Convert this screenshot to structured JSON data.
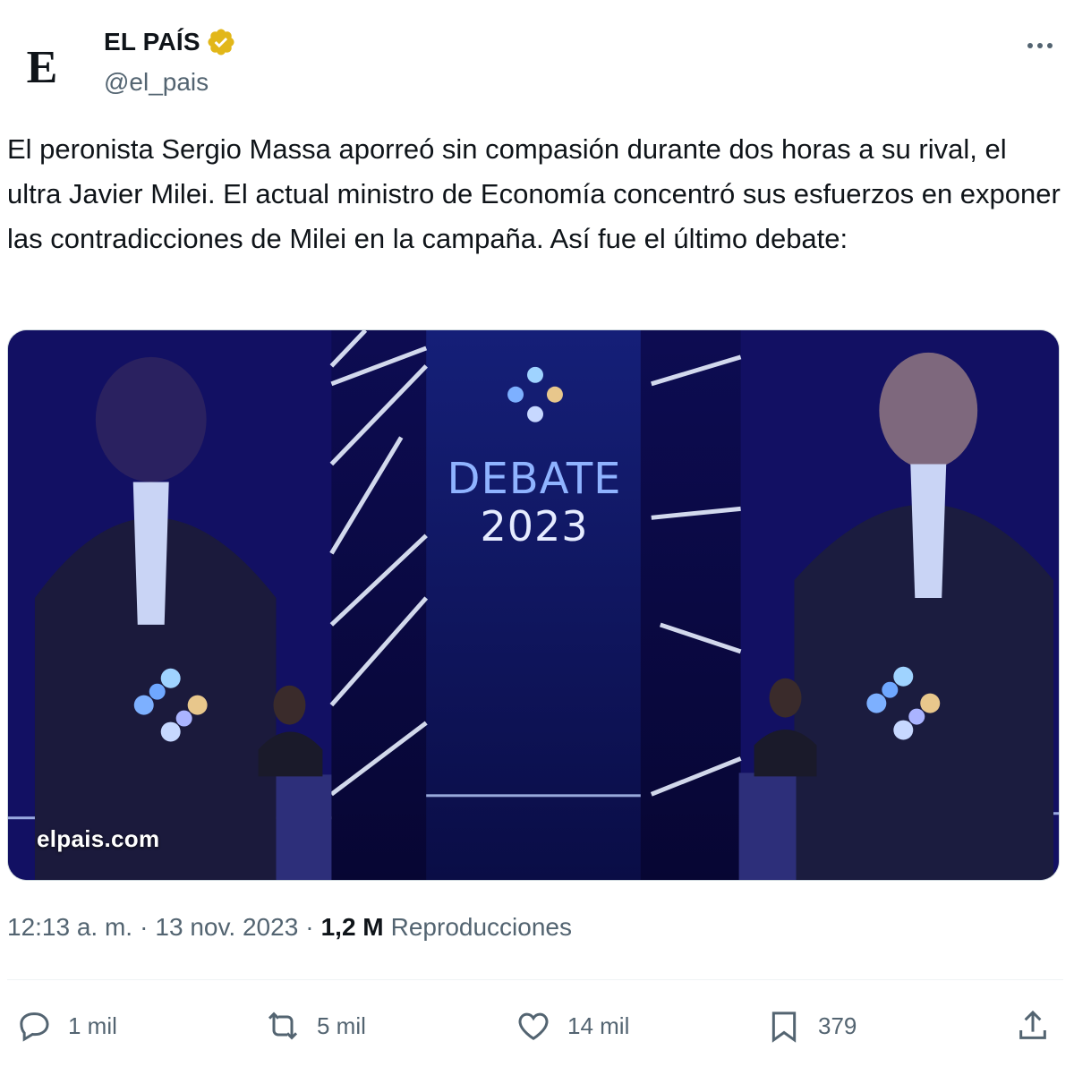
{
  "account": {
    "name": "EL PAÍS",
    "handle": "@el_pais",
    "avatar_letter": "E",
    "verified_badge_color": "#e2b719"
  },
  "tweet": {
    "text": "El peronista Sergio Massa aporreó sin compasión durante dos horas a su rival, el ultra Javier Milei. El actual ministro de Economía concentró sus esfuerzos en exponer las contradicciones de Milei en la campaña. Así fue el último debate:"
  },
  "media": {
    "watermark": "elpais.com",
    "screen_title": "DEBATE",
    "screen_year": "2023",
    "background_color": "#0b0a4a"
  },
  "meta": {
    "time": "12:13 a. m.",
    "separator": "·",
    "date": "13 nov. 2023",
    "separator2": "·",
    "views_count": "1,2 M",
    "views_label": "Reproducciones"
  },
  "actions": {
    "reply_count": "1 mil",
    "retweet_count": "5 mil",
    "like_count": "14 mil",
    "bookmark_count": "379"
  },
  "icons": {
    "more": "more-icon",
    "reply": "reply-icon",
    "retweet": "retweet-icon",
    "like": "like-icon",
    "bookmark": "bookmark-icon",
    "share": "share-icon"
  }
}
